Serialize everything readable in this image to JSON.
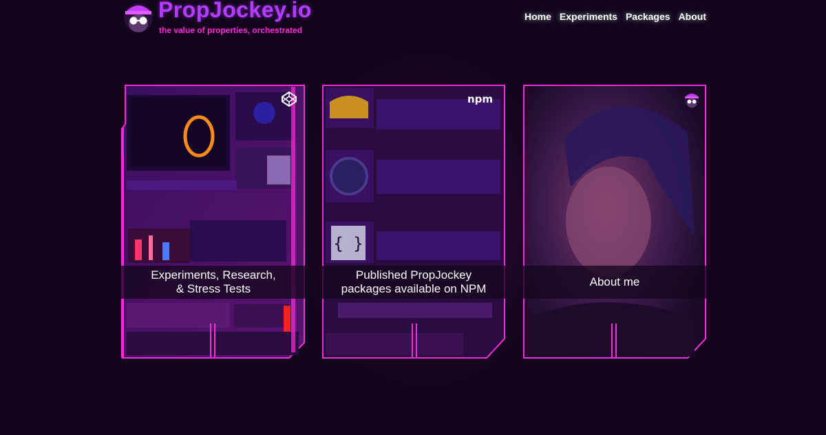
{
  "site": {
    "title": "PropJockey.io",
    "tagline": "the value of properties, orchestrated"
  },
  "nav": {
    "items": [
      {
        "label": "Home"
      },
      {
        "label": "Experiments"
      },
      {
        "label": "Packages"
      },
      {
        "label": "About"
      }
    ]
  },
  "cards": [
    {
      "line1": "Experiments, Research,",
      "line2": "& Stress Tests",
      "icon": "codepen-icon"
    },
    {
      "line1": "Published PropJockey",
      "line2": "packages available on NPM",
      "icon": "npm-icon",
      "badge": "npm"
    },
    {
      "line1": "About me",
      "line2": "",
      "icon": "avatar-icon"
    }
  ],
  "colors": {
    "background": "#12061c",
    "accent_pink": "#ff2bd9",
    "accent_purple": "#b23cff"
  }
}
